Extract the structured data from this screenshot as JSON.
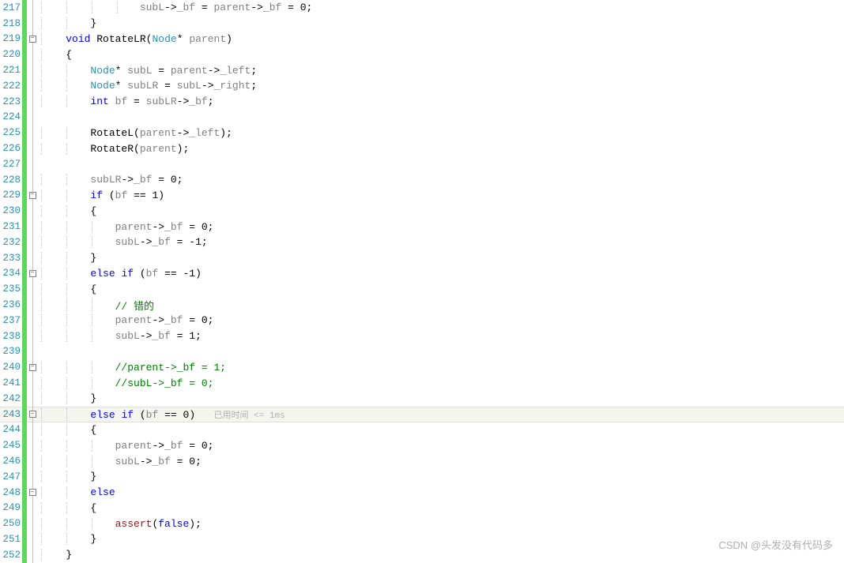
{
  "watermark": "CSDN @头发没有代码多",
  "hint": "已用时间 <= 1ms",
  "lines": [
    {
      "num": "217",
      "fold": false,
      "guides": [
        1,
        2,
        3,
        4
      ],
      "hl": false,
      "tokens": [
        [
          "",
          "                "
        ],
        [
          "id",
          "subL"
        ],
        [
          "plain",
          "->"
        ],
        [
          "id",
          "_bf"
        ],
        [
          "plain",
          " = "
        ],
        [
          "id",
          "parent"
        ],
        [
          "plain",
          "->"
        ],
        [
          "id",
          "_bf"
        ],
        [
          "plain",
          " = "
        ],
        [
          "num",
          "0"
        ],
        [
          "plain",
          ";"
        ]
      ]
    },
    {
      "num": "218",
      "fold": false,
      "guides": [
        1,
        2
      ],
      "hl": false,
      "tokens": [
        [
          "",
          "        "
        ],
        [
          "plain",
          "}"
        ]
      ]
    },
    {
      "num": "219",
      "fold": true,
      "guides": [
        1
      ],
      "hl": false,
      "tokens": [
        [
          "",
          "    "
        ],
        [
          "kw",
          "void"
        ],
        [
          "",
          " "
        ],
        [
          "plain",
          "RotateLR"
        ],
        [
          "plain",
          "("
        ],
        [
          "type",
          "Node"
        ],
        [
          "plain",
          "* "
        ],
        [
          "id",
          "parent"
        ],
        [
          "plain",
          ")"
        ]
      ]
    },
    {
      "num": "220",
      "fold": false,
      "guides": [
        1
      ],
      "hl": false,
      "tokens": [
        [
          "",
          "    "
        ],
        [
          "plain",
          "{"
        ]
      ]
    },
    {
      "num": "221",
      "fold": false,
      "guides": [
        1,
        2
      ],
      "hl": false,
      "tokens": [
        [
          "",
          "        "
        ],
        [
          "type",
          "Node"
        ],
        [
          "plain",
          "* "
        ],
        [
          "id",
          "subL"
        ],
        [
          "plain",
          " = "
        ],
        [
          "id",
          "parent"
        ],
        [
          "plain",
          "->"
        ],
        [
          "id",
          "_left"
        ],
        [
          "plain",
          ";"
        ]
      ]
    },
    {
      "num": "222",
      "fold": false,
      "guides": [
        1,
        2
      ],
      "hl": false,
      "tokens": [
        [
          "",
          "        "
        ],
        [
          "type",
          "Node"
        ],
        [
          "plain",
          "* "
        ],
        [
          "id",
          "subLR"
        ],
        [
          "plain",
          " = "
        ],
        [
          "id",
          "subL"
        ],
        [
          "plain",
          "->"
        ],
        [
          "id",
          "_right"
        ],
        [
          "plain",
          ";"
        ]
      ]
    },
    {
      "num": "223",
      "fold": false,
      "guides": [
        1,
        2
      ],
      "hl": false,
      "tokens": [
        [
          "",
          "        "
        ],
        [
          "kw",
          "int"
        ],
        [
          "",
          " "
        ],
        [
          "id",
          "bf"
        ],
        [
          "plain",
          " = "
        ],
        [
          "id",
          "subLR"
        ],
        [
          "plain",
          "->"
        ],
        [
          "id",
          "_bf"
        ],
        [
          "plain",
          ";"
        ]
      ]
    },
    {
      "num": "224",
      "fold": false,
      "guides": [
        1,
        2
      ],
      "hl": false,
      "tokens": []
    },
    {
      "num": "225",
      "fold": false,
      "guides": [
        1,
        2
      ],
      "hl": false,
      "tokens": [
        [
          "",
          "        "
        ],
        [
          "plain",
          "RotateL"
        ],
        [
          "plain",
          "("
        ],
        [
          "id",
          "parent"
        ],
        [
          "plain",
          "->"
        ],
        [
          "id",
          "_left"
        ],
        [
          "plain",
          ")"
        ],
        [
          "plain",
          ";"
        ]
      ]
    },
    {
      "num": "226",
      "fold": false,
      "guides": [
        1,
        2
      ],
      "hl": false,
      "tokens": [
        [
          "",
          "        "
        ],
        [
          "plain",
          "RotateR"
        ],
        [
          "plain",
          "("
        ],
        [
          "id",
          "parent"
        ],
        [
          "plain",
          ")"
        ],
        [
          "plain",
          ";"
        ]
      ]
    },
    {
      "num": "227",
      "fold": false,
      "guides": [
        1,
        2
      ],
      "hl": false,
      "tokens": []
    },
    {
      "num": "228",
      "fold": false,
      "guides": [
        1,
        2
      ],
      "hl": false,
      "tokens": [
        [
          "",
          "        "
        ],
        [
          "id",
          "subLR"
        ],
        [
          "plain",
          "->"
        ],
        [
          "id",
          "_bf"
        ],
        [
          "plain",
          " = "
        ],
        [
          "num",
          "0"
        ],
        [
          "plain",
          ";"
        ]
      ]
    },
    {
      "num": "229",
      "fold": true,
      "guides": [
        1,
        2
      ],
      "hl": false,
      "tokens": [
        [
          "",
          "        "
        ],
        [
          "kw",
          "if"
        ],
        [
          "plain",
          " ("
        ],
        [
          "id",
          "bf"
        ],
        [
          "plain",
          " == "
        ],
        [
          "num",
          "1"
        ],
        [
          "plain",
          ")"
        ]
      ]
    },
    {
      "num": "230",
      "fold": false,
      "guides": [
        1,
        2
      ],
      "hl": false,
      "tokens": [
        [
          "",
          "        "
        ],
        [
          "plain",
          "{"
        ]
      ]
    },
    {
      "num": "231",
      "fold": false,
      "guides": [
        1,
        2,
        3
      ],
      "hl": false,
      "tokens": [
        [
          "",
          "            "
        ],
        [
          "id",
          "parent"
        ],
        [
          "plain",
          "->"
        ],
        [
          "id",
          "_bf"
        ],
        [
          "plain",
          " = "
        ],
        [
          "num",
          "0"
        ],
        [
          "plain",
          ";"
        ]
      ]
    },
    {
      "num": "232",
      "fold": false,
      "guides": [
        1,
        2,
        3
      ],
      "hl": false,
      "tokens": [
        [
          "",
          "            "
        ],
        [
          "id",
          "subL"
        ],
        [
          "plain",
          "->"
        ],
        [
          "id",
          "_bf"
        ],
        [
          "plain",
          " = "
        ],
        [
          "num",
          "-1"
        ],
        [
          "plain",
          ";"
        ]
      ]
    },
    {
      "num": "233",
      "fold": false,
      "guides": [
        1,
        2
      ],
      "hl": false,
      "tokens": [
        [
          "",
          "        "
        ],
        [
          "plain",
          "}"
        ]
      ]
    },
    {
      "num": "234",
      "fold": true,
      "guides": [
        1,
        2
      ],
      "hl": false,
      "tokens": [
        [
          "",
          "        "
        ],
        [
          "kw",
          "else"
        ],
        [
          "",
          " "
        ],
        [
          "kw",
          "if"
        ],
        [
          "plain",
          " ("
        ],
        [
          "id",
          "bf"
        ],
        [
          "plain",
          " == "
        ],
        [
          "num",
          "-1"
        ],
        [
          "plain",
          ")"
        ]
      ]
    },
    {
      "num": "235",
      "fold": false,
      "guides": [
        1,
        2
      ],
      "hl": false,
      "tokens": [
        [
          "",
          "        "
        ],
        [
          "plain",
          "{"
        ]
      ]
    },
    {
      "num": "236",
      "fold": false,
      "guides": [
        1,
        2,
        3
      ],
      "hl": false,
      "tokens": [
        [
          "",
          "            "
        ],
        [
          "cmt",
          "// 错的"
        ]
      ]
    },
    {
      "num": "237",
      "fold": false,
      "guides": [
        1,
        2,
        3
      ],
      "hl": false,
      "tokens": [
        [
          "",
          "            "
        ],
        [
          "id",
          "parent"
        ],
        [
          "plain",
          "->"
        ],
        [
          "id",
          "_bf"
        ],
        [
          "plain",
          " = "
        ],
        [
          "num",
          "0"
        ],
        [
          "plain",
          ";"
        ]
      ]
    },
    {
      "num": "238",
      "fold": false,
      "guides": [
        1,
        2,
        3
      ],
      "hl": false,
      "tokens": [
        [
          "",
          "            "
        ],
        [
          "id",
          "subL"
        ],
        [
          "plain",
          "->"
        ],
        [
          "id",
          "_bf"
        ],
        [
          "plain",
          " = "
        ],
        [
          "num",
          "1"
        ],
        [
          "plain",
          ";"
        ]
      ]
    },
    {
      "num": "239",
      "fold": false,
      "guides": [
        1,
        2,
        3
      ],
      "hl": false,
      "tokens": []
    },
    {
      "num": "240",
      "fold": true,
      "guides": [
        1,
        2,
        3
      ],
      "hl": false,
      "tokens": [
        [
          "",
          "            "
        ],
        [
          "cmt",
          "//parent->_bf = 1;"
        ]
      ]
    },
    {
      "num": "241",
      "fold": false,
      "guides": [
        1,
        2,
        3
      ],
      "hl": false,
      "tokens": [
        [
          "",
          "            "
        ],
        [
          "cmt",
          "//subL->_bf = 0;"
        ]
      ]
    },
    {
      "num": "242",
      "fold": false,
      "guides": [
        1,
        2
      ],
      "hl": false,
      "tokens": [
        [
          "",
          "        "
        ],
        [
          "plain",
          "}"
        ]
      ]
    },
    {
      "num": "243",
      "fold": true,
      "guides": [
        1,
        2
      ],
      "hl": true,
      "tokens": [
        [
          "",
          "        "
        ],
        [
          "kw",
          "else"
        ],
        [
          "",
          " "
        ],
        [
          "kw",
          "if"
        ],
        [
          "plain",
          " ("
        ],
        [
          "id",
          "bf"
        ],
        [
          "plain",
          " == "
        ],
        [
          "num",
          "0"
        ],
        [
          "plain",
          ")   "
        ],
        [
          "hint",
          "已用时间 <= 1ms"
        ]
      ]
    },
    {
      "num": "244",
      "fold": false,
      "guides": [
        1,
        2
      ],
      "hl": false,
      "tokens": [
        [
          "",
          "        "
        ],
        [
          "plain",
          "{"
        ]
      ]
    },
    {
      "num": "245",
      "fold": false,
      "guides": [
        1,
        2,
        3
      ],
      "hl": false,
      "tokens": [
        [
          "",
          "            "
        ],
        [
          "id",
          "parent"
        ],
        [
          "plain",
          "->"
        ],
        [
          "id",
          "_bf"
        ],
        [
          "plain",
          " = "
        ],
        [
          "num",
          "0"
        ],
        [
          "plain",
          ";"
        ]
      ]
    },
    {
      "num": "246",
      "fold": false,
      "guides": [
        1,
        2,
        3
      ],
      "hl": false,
      "tokens": [
        [
          "",
          "            "
        ],
        [
          "id",
          "subL"
        ],
        [
          "plain",
          "->"
        ],
        [
          "id",
          "_bf"
        ],
        [
          "plain",
          " = "
        ],
        [
          "num",
          "0"
        ],
        [
          "plain",
          ";"
        ]
      ]
    },
    {
      "num": "247",
      "fold": false,
      "guides": [
        1,
        2
      ],
      "hl": false,
      "tokens": [
        [
          "",
          "        "
        ],
        [
          "plain",
          "}"
        ]
      ]
    },
    {
      "num": "248",
      "fold": true,
      "guides": [
        1,
        2
      ],
      "hl": false,
      "tokens": [
        [
          "",
          "        "
        ],
        [
          "kw",
          "else"
        ]
      ]
    },
    {
      "num": "249",
      "fold": false,
      "guides": [
        1,
        2
      ],
      "hl": false,
      "tokens": [
        [
          "",
          "        "
        ],
        [
          "plain",
          "{"
        ]
      ]
    },
    {
      "num": "250",
      "fold": false,
      "guides": [
        1,
        2,
        3
      ],
      "hl": false,
      "tokens": [
        [
          "",
          "            "
        ],
        [
          "brk",
          "assert"
        ],
        [
          "plain",
          "("
        ],
        [
          "kw",
          "false"
        ],
        [
          "plain",
          ")"
        ],
        [
          "plain",
          ";"
        ]
      ]
    },
    {
      "num": "251",
      "fold": false,
      "guides": [
        1,
        2
      ],
      "hl": false,
      "tokens": [
        [
          "",
          "        "
        ],
        [
          "plain",
          "}"
        ]
      ]
    },
    {
      "num": "252",
      "fold": false,
      "guides": [
        1
      ],
      "hl": false,
      "tokens": [
        [
          "",
          "    "
        ],
        [
          "plain",
          "}"
        ]
      ]
    }
  ]
}
